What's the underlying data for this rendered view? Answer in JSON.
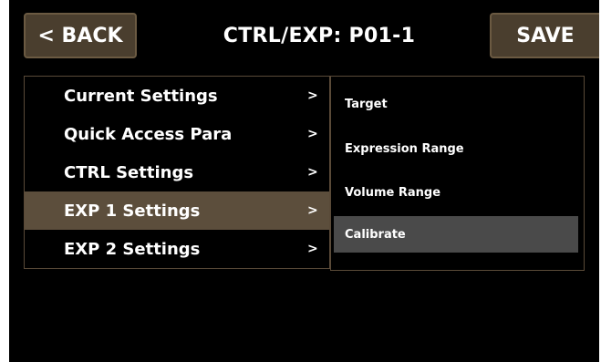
{
  "header": {
    "back_label": "< BACK",
    "title": "CTRL/EXP: P01-1",
    "save_label": "SAVE"
  },
  "menu": {
    "items": [
      {
        "label": "Current Settings",
        "arrow": ">",
        "selected": false
      },
      {
        "label": "Quick Access Para",
        "arrow": ">",
        "selected": false
      },
      {
        "label": "CTRL Settings",
        "arrow": ">",
        "selected": false
      },
      {
        "label": "EXP 1 Settings",
        "arrow": ">",
        "selected": true
      },
      {
        "label": "EXP 2 Settings",
        "arrow": ">",
        "selected": false
      }
    ]
  },
  "submenu": {
    "items": [
      {
        "label": "Target",
        "selected": false
      },
      {
        "label": "Expression Range",
        "selected": false
      },
      {
        "label": "Volume Range",
        "selected": false
      },
      {
        "label": "Calibrate",
        "selected": true
      }
    ]
  },
  "colors": {
    "button_bg": "#4a3e2e",
    "menu_selected_bg": "#5c4e3c",
    "submenu_selected_bg": "#4a4a4a",
    "border": "#5a4a38"
  }
}
